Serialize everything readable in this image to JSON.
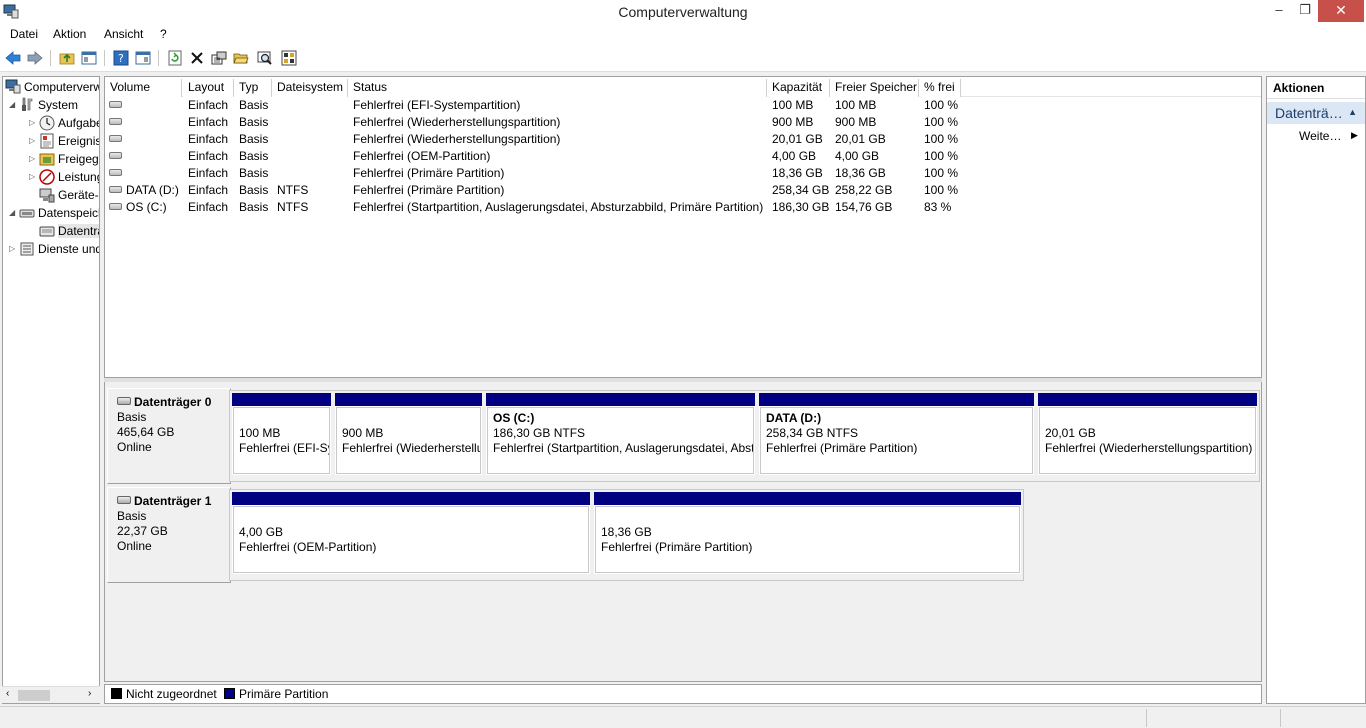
{
  "window": {
    "title": "Computerverwaltung",
    "minimize": "–",
    "maximize": "❐",
    "close": "✕"
  },
  "menu": [
    {
      "label": "Datei"
    },
    {
      "label": "Aktion"
    },
    {
      "label": "Ansicht"
    },
    {
      "label": "?"
    }
  ],
  "toolbar_icons": [
    "back-arrow-icon",
    "forward-arrow-icon",
    "up-folder-icon",
    "show-hide-tree-icon",
    "help-icon",
    "show-hide-action-pane-icon",
    "refresh-icon",
    "delete-icon",
    "properties-icon",
    "open-folder-icon",
    "search-icon",
    "settings-icon"
  ],
  "tree": {
    "root": "Computerverwaltung (Lokal)",
    "items": [
      {
        "label": "Computerverwaltung (Lokal)",
        "icon": "computer-management-icon"
      },
      {
        "label": "System",
        "icon": "system-tools-icon"
      },
      {
        "label": "Aufgabenplanung",
        "icon": "task-scheduler-icon"
      },
      {
        "label": "Ereignisanzeige",
        "icon": "event-viewer-icon"
      },
      {
        "label": "Freigegebene Ordner",
        "icon": "shared-folders-icon"
      },
      {
        "label": "Leistung",
        "icon": "performance-icon"
      },
      {
        "label": "Geräte-Manager",
        "icon": "device-manager-icon"
      },
      {
        "label": "Datenspeicher",
        "icon": "storage-icon"
      },
      {
        "label": "Datenträgerverwaltung",
        "icon": "disk-management-icon"
      },
      {
        "label": "Dienste und Anwendungen",
        "icon": "services-icon"
      }
    ]
  },
  "volumes": {
    "columns": [
      "Volume",
      "Layout",
      "Typ",
      "Dateisystem",
      "Status",
      "Kapazität",
      "Freier Speicher",
      "% frei"
    ],
    "rows": [
      {
        "volume": "",
        "layout": "Einfach",
        "typ": "Basis",
        "fs": "",
        "status": "Fehlerfrei (EFI-Systempartition)",
        "cap": "100 MB",
        "free": "100 MB",
        "pct": "100 %"
      },
      {
        "volume": "",
        "layout": "Einfach",
        "typ": "Basis",
        "fs": "",
        "status": "Fehlerfrei (Wiederherstellungspartition)",
        "cap": "900 MB",
        "free": "900 MB",
        "pct": "100 %"
      },
      {
        "volume": "",
        "layout": "Einfach",
        "typ": "Basis",
        "fs": "",
        "status": "Fehlerfrei (Wiederherstellungspartition)",
        "cap": "20,01 GB",
        "free": "20,01 GB",
        "pct": "100 %"
      },
      {
        "volume": "",
        "layout": "Einfach",
        "typ": "Basis",
        "fs": "",
        "status": "Fehlerfrei (OEM-Partition)",
        "cap": "4,00 GB",
        "free": "4,00 GB",
        "pct": "100 %"
      },
      {
        "volume": "",
        "layout": "Einfach",
        "typ": "Basis",
        "fs": "",
        "status": "Fehlerfrei (Primäre Partition)",
        "cap": "18,36 GB",
        "free": "18,36 GB",
        "pct": "100 %"
      },
      {
        "volume": "DATA (D:)",
        "layout": "Einfach",
        "typ": "Basis",
        "fs": "NTFS",
        "status": "Fehlerfrei (Primäre Partition)",
        "cap": "258,34 GB",
        "free": "258,22 GB",
        "pct": "100 %"
      },
      {
        "volume": "OS (C:)",
        "layout": "Einfach",
        "typ": "Basis",
        "fs": "NTFS",
        "status": "Fehlerfrei (Startpartition, Auslagerungsdatei, Absturzabbild, Primäre Partition)",
        "cap": "186,30 GB",
        "free": "154,76 GB",
        "pct": "83 %"
      }
    ]
  },
  "disks": [
    {
      "name": "Datenträger 0",
      "type": "Basis",
      "size": "465,64 GB",
      "state": "Online",
      "partitions": [
        {
          "name": "",
          "size": "100 MB",
          "status": "Fehlerfrei (EFI-Systempartition)"
        },
        {
          "name": "",
          "size": "900 MB",
          "status": "Fehlerfrei (Wiederherstellungspartition)"
        },
        {
          "name": "OS  (C:)",
          "size": "186,30 GB NTFS",
          "status": "Fehlerfrei (Startpartition, Auslagerungsdatei, Absturzabbild, Primäre Partition)"
        },
        {
          "name": "DATA  (D:)",
          "size": "258,34 GB NTFS",
          "status": "Fehlerfrei (Primäre Partition)"
        },
        {
          "name": "",
          "size": "20,01 GB",
          "status": "Fehlerfrei (Wiederherstellungspartition)"
        }
      ]
    },
    {
      "name": "Datenträger 1",
      "type": "Basis",
      "size": "22,37 GB",
      "state": "Online",
      "partitions": [
        {
          "name": "",
          "size": "4,00 GB",
          "status": "Fehlerfrei (OEM-Partition)"
        },
        {
          "name": "",
          "size": "18,36 GB",
          "status": "Fehlerfrei (Primäre Partition)"
        }
      ]
    }
  ],
  "legend": [
    {
      "label": "Nicht zugeordnet",
      "color": "#000000"
    },
    {
      "label": "Primäre Partition",
      "color": "#000080"
    }
  ],
  "actions": {
    "title": "Aktionen",
    "section": "Datenträgerverwaltung",
    "more": "Weitere Aktionen"
  },
  "colors": {
    "primary_partition": "#000080",
    "close_button": "#c7504a",
    "selection": "#dbe7f4"
  }
}
